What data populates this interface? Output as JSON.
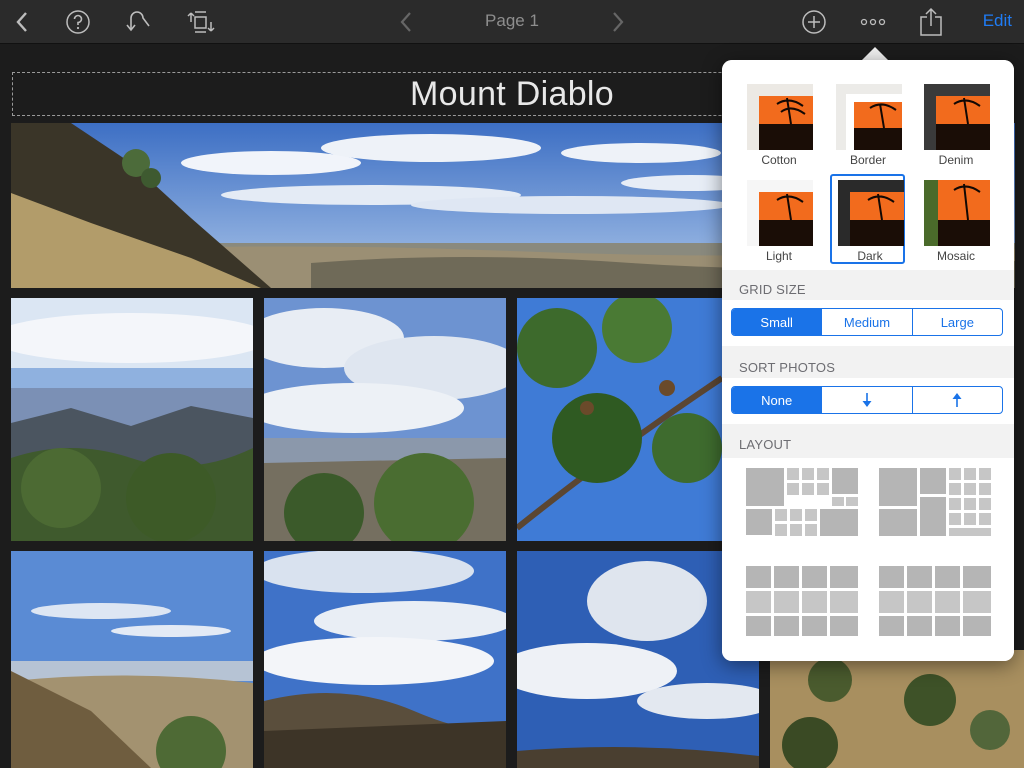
{
  "toolbar": {
    "back_icon": "chevron-left-icon",
    "help_icon": "question-mark-circle-icon",
    "undo_icon": "undo-arrow-icon",
    "rotate_icon": "rotate-crop-icon",
    "prev_page_icon": "chevron-left-icon",
    "page_label": "Page 1",
    "next_page_icon": "chevron-right-icon",
    "add_icon": "plus-circle-icon",
    "more_icon": "ellipsis-icon",
    "share_icon": "share-icon",
    "edit_label": "Edit",
    "accent_color": "#1f7cf5"
  },
  "album": {
    "title": "Mount Diablo"
  },
  "popover": {
    "themes": [
      {
        "name": "Cotton",
        "selected": false
      },
      {
        "name": "Border",
        "selected": false
      },
      {
        "name": "Denim",
        "selected": false
      },
      {
        "name": "Light",
        "selected": false
      },
      {
        "name": "Dark",
        "selected": true
      },
      {
        "name": "Mosaic",
        "selected": false
      }
    ],
    "grid_size": {
      "header": "GRID SIZE",
      "options": [
        "Small",
        "Medium",
        "Large"
      ],
      "selected": "Small"
    },
    "sort_photos": {
      "header": "SORT PHOTOS",
      "options": [
        "None",
        "arrow-down-icon",
        "arrow-up-icon"
      ],
      "selected": "None"
    },
    "layout": {
      "header": "LAYOUT"
    },
    "selection_color": "#1a73e8"
  }
}
